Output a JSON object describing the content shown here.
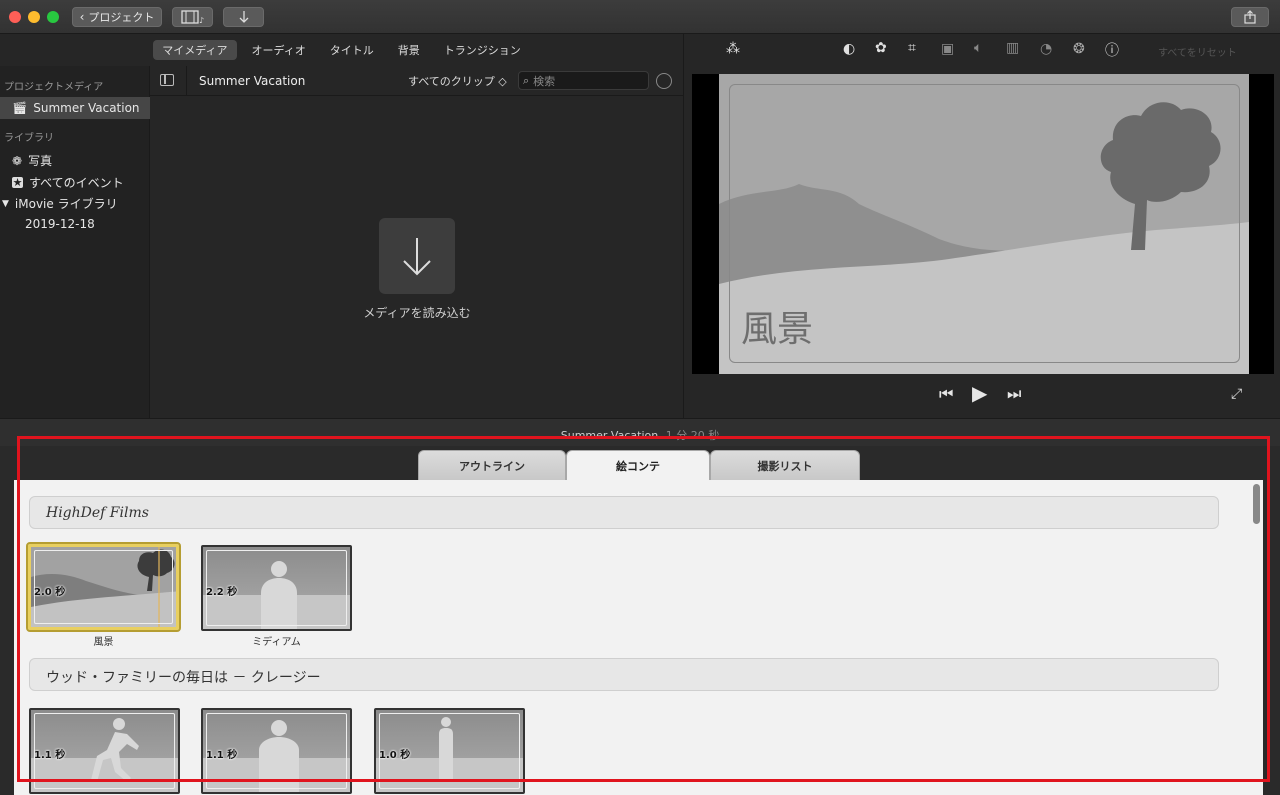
{
  "titlebar": {
    "back_label": "プロジェクト",
    "icons": [
      "media-browser-icon",
      "import-icon",
      "share-icon"
    ]
  },
  "media_tabs": [
    "マイメディア",
    "オーディオ",
    "タイトル",
    "背景",
    "トランジション"
  ],
  "sidebar": {
    "project_media_header": "プロジェクトメディア",
    "project_item": "Summer Vacation",
    "library_header": "ライブラリ",
    "photos": "写真",
    "all_events": "すべてのイベント",
    "imovie_library": "iMovie ライブラリ",
    "event_date": "2019-12-18"
  },
  "clipbar": {
    "title": "Summer Vacation",
    "filter": "すべてのクリップ ◇",
    "search_placeholder": "検索"
  },
  "import": {
    "label": "メディアを読み込む"
  },
  "viewer": {
    "reset_label": "すべてをリセット",
    "scene_title": "風景"
  },
  "timeline": {
    "project_title": "Summer Vacation",
    "duration": "1 分 20 秒"
  },
  "storyboard": {
    "tabs": [
      "アウトライン",
      "絵コンテ",
      "撮影リスト"
    ],
    "active_tab": "絵コンテ",
    "groups": [
      {
        "label": "HighDef Films",
        "clips": [
          {
            "duration": "2.0 秒",
            "label": "風景"
          },
          {
            "duration": "2.2 秒",
            "label": "ミディアム"
          }
        ]
      },
      {
        "label": "ウッド・ファミリーの毎日は － クレージー",
        "clips": [
          {
            "duration": "1.1 秒",
            "label": ""
          },
          {
            "duration": "1.1 秒",
            "label": ""
          },
          {
            "duration": "1.0 秒",
            "label": ""
          }
        ]
      }
    ]
  },
  "colors": {
    "highlight": "#e0141e",
    "selected_clip": "#e8cf60"
  }
}
